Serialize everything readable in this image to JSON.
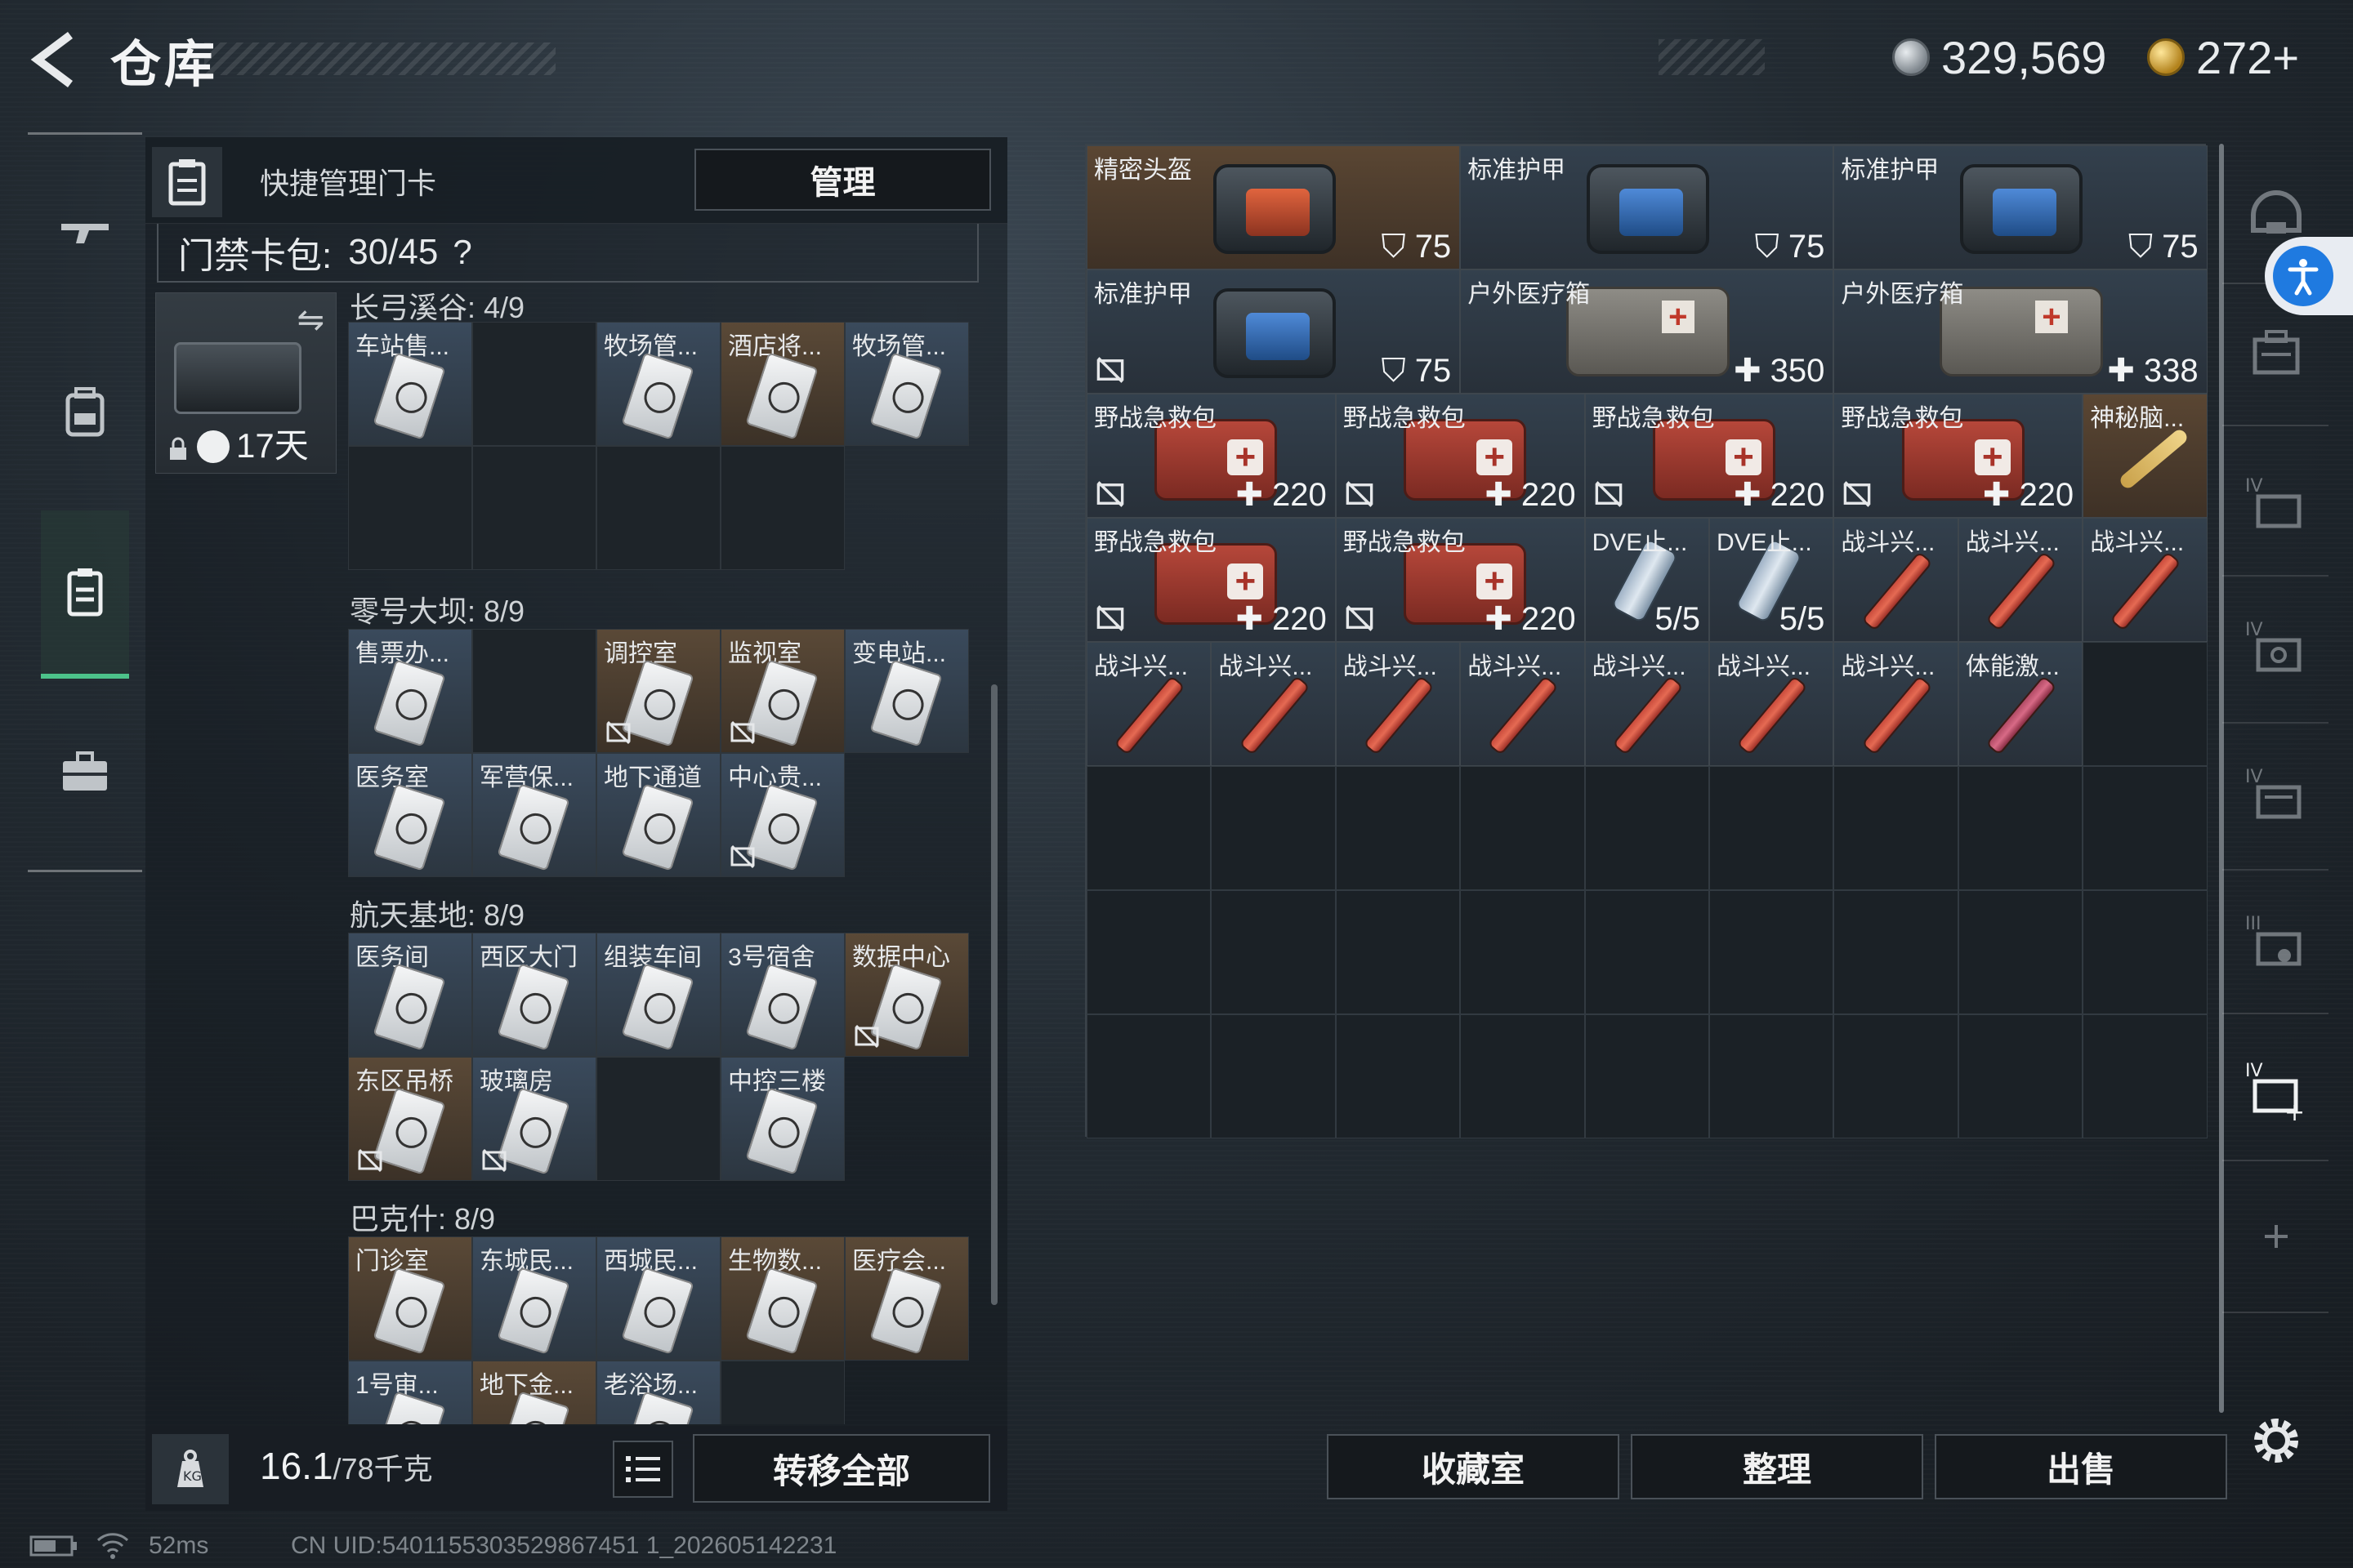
{
  "header": {
    "title": "仓库",
    "currency_silver": "329,569",
    "currency_gold": "272+"
  },
  "left_panel": {
    "header_label": "快捷管理门卡",
    "manage_label": "管理",
    "card_pack_label": "门禁卡包:",
    "card_pack_count": "30/45",
    "help_glyph": "?",
    "case_days": "17天",
    "sections": [
      {
        "title": "长弓溪谷: 4/9",
        "cards": [
          {
            "name": "车站售...",
            "kind": "filled"
          },
          {
            "name": "",
            "kind": "empty"
          },
          {
            "name": "牧场管...",
            "kind": "filled"
          },
          {
            "name": "酒店将...",
            "kind": "brown"
          },
          {
            "name": "牧场管...",
            "kind": "filled"
          },
          {
            "name": "",
            "kind": "empty"
          },
          {
            "name": "",
            "kind": "empty"
          },
          {
            "name": "",
            "kind": "empty"
          },
          {
            "name": "",
            "kind": "empty"
          }
        ]
      },
      {
        "title": "零号大坝: 8/9",
        "cards": [
          {
            "name": "售票办...",
            "kind": "filled"
          },
          {
            "name": "",
            "kind": "empty"
          },
          {
            "name": "调控室",
            "kind": "brown",
            "nosell": true
          },
          {
            "name": "监视室",
            "kind": "brown",
            "nosell": true
          },
          {
            "name": "变电站...",
            "kind": "filled"
          },
          {
            "name": "医务室",
            "kind": "filled"
          },
          {
            "name": "军营保...",
            "kind": "filled"
          },
          {
            "name": "地下通道",
            "kind": "filled"
          },
          {
            "name": "中心贵...",
            "kind": "filled",
            "nosell": true
          }
        ]
      },
      {
        "title": "航天基地: 8/9",
        "cards": [
          {
            "name": "医务间",
            "kind": "filled"
          },
          {
            "name": "西区大门",
            "kind": "filled"
          },
          {
            "name": "组装车间",
            "kind": "filled"
          },
          {
            "name": "3号宿舍",
            "kind": "filled"
          },
          {
            "name": "数据中心",
            "kind": "brown",
            "nosell": true
          },
          {
            "name": "东区吊桥",
            "kind": "brown",
            "nosell": true
          },
          {
            "name": "玻璃房",
            "kind": "filled",
            "nosell": true
          },
          {
            "name": "",
            "kind": "empty"
          },
          {
            "name": "中控三楼",
            "kind": "filled"
          }
        ]
      },
      {
        "title": "巴克什: 8/9",
        "cards": [
          {
            "name": "门诊室",
            "kind": "brown"
          },
          {
            "name": "东城民...",
            "kind": "filled"
          },
          {
            "name": "西城民...",
            "kind": "filled"
          },
          {
            "name": "生物数...",
            "kind": "brown"
          },
          {
            "name": "医疗会...",
            "kind": "brown"
          },
          {
            "name": "1号审...",
            "kind": "filled"
          },
          {
            "name": "地下金...",
            "kind": "brown"
          },
          {
            "name": "老浴场...",
            "kind": "filled"
          },
          {
            "name": "",
            "kind": "empty"
          }
        ]
      }
    ],
    "footer": {
      "weight_value": "16.1",
      "weight_unit": "/78千克",
      "transfer_all_label": "转移全部"
    }
  },
  "stash": {
    "items": [
      {
        "name": "精密头盔",
        "value": "75",
        "icon": "shield",
        "kind": "brown",
        "type": "armor-orange"
      },
      {
        "name": "标准护甲",
        "value": "75",
        "icon": "shield",
        "kind": "blue",
        "type": "armor-blue"
      },
      {
        "name": "标准护甲",
        "value": "75",
        "icon": "shield",
        "kind": "blue",
        "type": "armor-blue"
      },
      {
        "name": "标准护甲",
        "value": "75",
        "icon": "shield",
        "kind": "blue",
        "type": "armor-blue",
        "nosell": true
      },
      {
        "name": "户外医疗箱",
        "value": "350",
        "icon": "plus",
        "kind": "blue",
        "type": "medbox"
      },
      {
        "name": "户外医疗箱",
        "value": "338",
        "icon": "plus",
        "kind": "blue",
        "type": "medbox"
      },
      {
        "name": "野战急救包",
        "value": "220",
        "icon": "plus",
        "kind": "blue",
        "type": "redkit",
        "nosell": true
      },
      {
        "name": "野战急救包",
        "value": "220",
        "icon": "plus",
        "kind": "blue",
        "type": "redkit",
        "nosell": true
      },
      {
        "name": "野战急救包",
        "value": "220",
        "icon": "plus",
        "kind": "blue",
        "type": "redkit",
        "nosell": true
      },
      {
        "name": "野战急救包",
        "value": "220",
        "icon": "plus",
        "kind": "blue",
        "type": "redkit",
        "nosell": true
      },
      {
        "name": "神秘脑...",
        "value": "",
        "icon": "",
        "kind": "brown",
        "type": "mystery"
      },
      {
        "name": "野战急救包",
        "value": "220",
        "icon": "plus",
        "kind": "blue",
        "type": "redkit",
        "nosell": true
      },
      {
        "name": "野战急救包",
        "value": "220",
        "icon": "plus",
        "kind": "blue",
        "type": "redkit",
        "nosell": true
      },
      {
        "name": "DVE止...",
        "value": "5/5",
        "icon": "",
        "kind": "blue",
        "type": "inhaler"
      },
      {
        "name": "DVE止...",
        "value": "5/5",
        "icon": "",
        "kind": "blue",
        "type": "inhaler"
      },
      {
        "name": "战斗兴...",
        "value": "",
        "icon": "",
        "kind": "blue",
        "type": "syringe"
      },
      {
        "name": "战斗兴...",
        "value": "",
        "icon": "",
        "kind": "blue",
        "type": "syringe"
      },
      {
        "name": "战斗兴...",
        "value": "",
        "icon": "",
        "kind": "blue",
        "type": "syringe"
      },
      {
        "name": "战斗兴...",
        "value": "",
        "icon": "",
        "kind": "blue",
        "type": "syringe"
      },
      {
        "name": "战斗兴...",
        "value": "",
        "icon": "",
        "kind": "blue",
        "type": "syringe"
      },
      {
        "name": "战斗兴...",
        "value": "",
        "icon": "",
        "kind": "blue",
        "type": "syringe"
      },
      {
        "name": "战斗兴...",
        "value": "",
        "icon": "",
        "kind": "blue",
        "type": "syringe"
      },
      {
        "name": "战斗兴...",
        "value": "",
        "icon": "",
        "kind": "blue",
        "type": "syringe"
      },
      {
        "name": "战斗兴...",
        "value": "",
        "icon": "",
        "kind": "blue",
        "type": "syringe"
      },
      {
        "name": "战斗兴...",
        "value": "",
        "icon": "",
        "kind": "blue",
        "type": "syringe"
      },
      {
        "name": "战斗兴...",
        "value": "",
        "icon": "",
        "kind": "blue",
        "type": "syringe"
      },
      {
        "name": "体能激...",
        "value": "",
        "icon": "",
        "kind": "blue",
        "type": "syringe-pink"
      }
    ]
  },
  "bottom_buttons": {
    "collection_label": "收藏室",
    "organize_label": "整理",
    "sell_label": "出售"
  },
  "status_bar": {
    "ping": "52ms",
    "uid": "CN UID:5401155303529867451 1_202605142231"
  },
  "colors": {
    "accent_green": "#4cc38a",
    "access_blue": "#1f7ae0"
  }
}
